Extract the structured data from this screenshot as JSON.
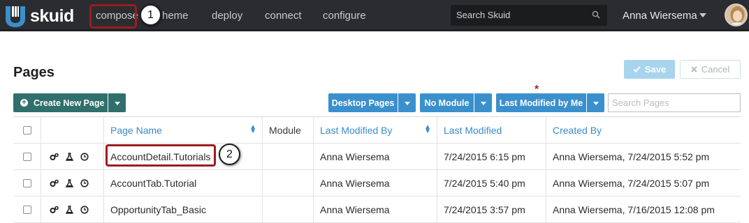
{
  "app": {
    "brand": "skuid"
  },
  "nav": {
    "items": [
      {
        "label": "compose"
      },
      {
        "label": "heme"
      },
      {
        "label": "deploy"
      },
      {
        "label": "connect"
      },
      {
        "label": "configure"
      }
    ],
    "search_placeholder": "Search Skuid",
    "user_name": "Anna Wiersema"
  },
  "callouts": [
    "1",
    "2"
  ],
  "page": {
    "title": "Pages",
    "save_label": "Save",
    "cancel_label": "Cancel"
  },
  "toolbar": {
    "create_label": "Create New Page",
    "filters": [
      {
        "label": "Desktop Pages"
      },
      {
        "label": "No Module"
      },
      {
        "label": "Last Modified by Me"
      }
    ],
    "filter_marker": "*",
    "search_placeholder": "Search Pages"
  },
  "table": {
    "columns": [
      "Page Name",
      "Module",
      "Last Modified By",
      "Last Modified",
      "Created By"
    ],
    "rows": [
      {
        "name": "AccountDetail.Tutorials",
        "module": "",
        "modified_by": "Anna Wiersema",
        "modified": "7/24/2015 6:15 pm",
        "created_by": "Anna Wiersema, 7/24/2015 5:52 pm"
      },
      {
        "name": "AccountTab.Tutorial",
        "module": "",
        "modified_by": "Anna Wiersema",
        "modified": "7/24/2015 5:40 pm",
        "created_by": "Anna Wiersema, 7/24/2015 5:07 pm"
      },
      {
        "name": "OpportunityTab_Basic",
        "module": "",
        "modified_by": "Anna Wiersema",
        "modified": "7/24/2015 3:57 pm",
        "created_by": "Anna Wiersema, 7/16/2015 12:08 pm"
      }
    ]
  },
  "colors": {
    "nav_bg": "#2a2c2f",
    "brand_teal": "#2f6f6c",
    "filter_blue": "#3a90cd",
    "link_blue": "#3a8bc8",
    "highlight_red": "#9b1c21"
  }
}
